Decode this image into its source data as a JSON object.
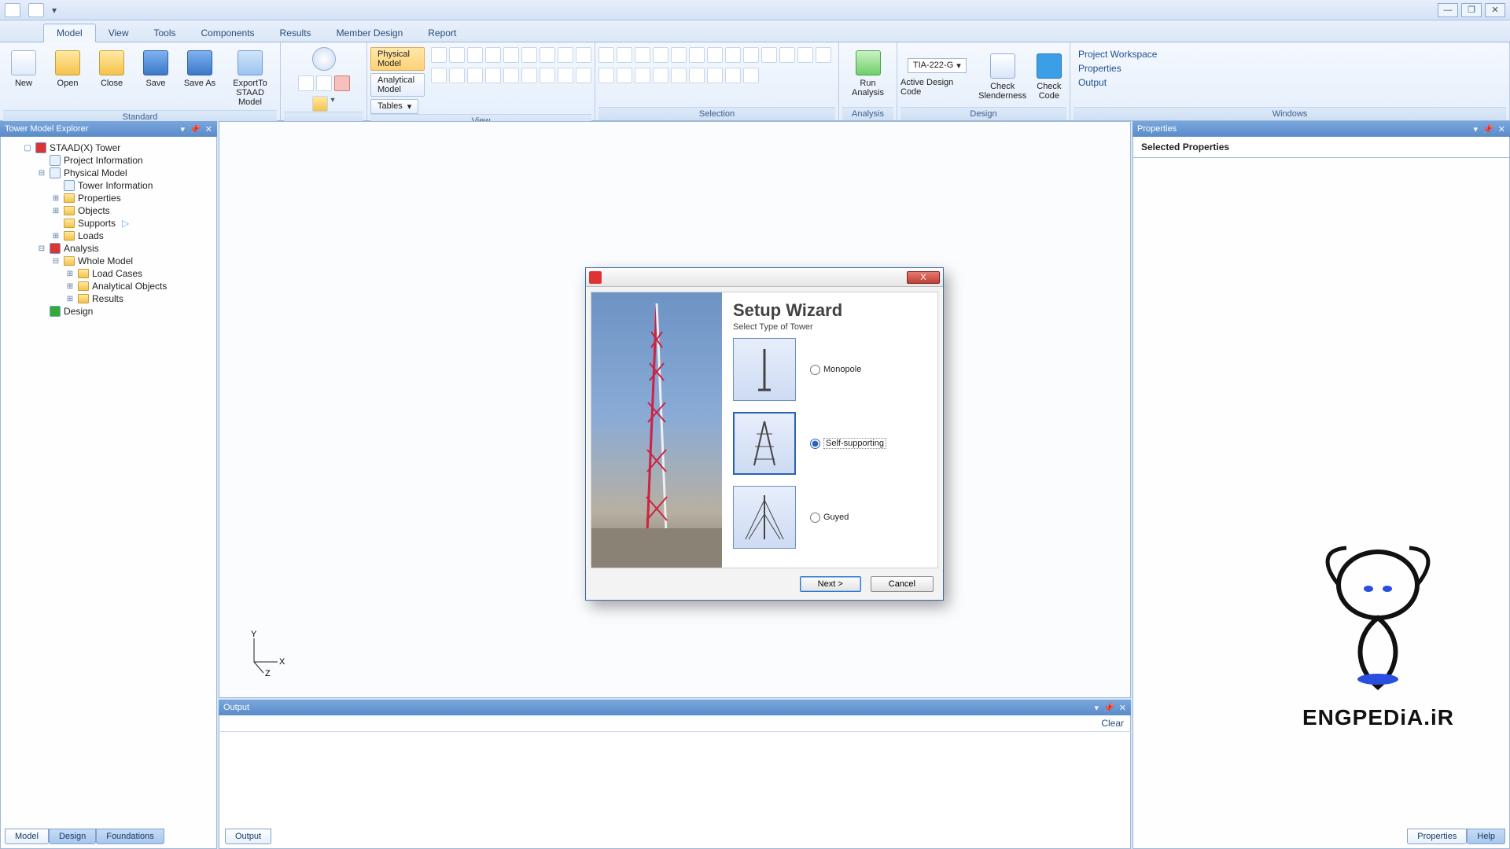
{
  "titlebar": {
    "min": "—",
    "max": "❐",
    "close": "✕"
  },
  "tabs": [
    "Model",
    "View",
    "Tools",
    "Components",
    "Results",
    "Member Design",
    "Report"
  ],
  "active_tab": 0,
  "ribbon": {
    "standard": {
      "label": "Standard",
      "buttons": [
        "New",
        "Open",
        "Close",
        "Save",
        "Save As",
        "ExportTo STAAD Model"
      ]
    },
    "view": {
      "label": "View",
      "stack": [
        "Physical Model",
        "Analytical Model",
        "Tables"
      ]
    },
    "selection": {
      "label": "Selection"
    },
    "analysis": {
      "label": "Analysis",
      "run": "Run Analysis"
    },
    "design": {
      "label": "Design",
      "code_value": "TIA-222-G",
      "active_code": "Active Design Code",
      "check_slender": "Check Slenderness",
      "check_code": "Check Code"
    },
    "windows": {
      "label": "Windows",
      "links": [
        "Project Workspace",
        "Properties",
        "Output"
      ]
    }
  },
  "explorer": {
    "title": "Tower Model Explorer",
    "root": "STAAD(X) Tower",
    "items": {
      "project_info": "Project Information",
      "physical_model": "Physical Model",
      "tower_info": "Tower Information",
      "properties": "Properties",
      "objects": "Objects",
      "supports": "Supports",
      "loads": "Loads",
      "analysis": "Analysis",
      "whole_model": "Whole Model",
      "load_cases": "Load Cases",
      "analytical_objects": "Analytical Objects",
      "results": "Results",
      "design": "Design"
    }
  },
  "axis": {
    "x": "X",
    "y": "Y",
    "z": "Z"
  },
  "output": {
    "title": "Output",
    "clear": "Clear",
    "tab": "Output"
  },
  "left_bottom_tabs": [
    "Model",
    "Design",
    "Foundations"
  ],
  "properties_panel": {
    "title": "Properties",
    "selected": "Selected Properties"
  },
  "right_bottom_tabs": [
    "Properties",
    "Help"
  ],
  "dialog": {
    "title": "Setup Wizard",
    "subtitle": "Select Type of Tower",
    "options": [
      "Monopole",
      "Self-supporting",
      "Guyed"
    ],
    "selected": 1,
    "next": "Next >",
    "cancel": "Cancel",
    "close": "X"
  },
  "watermark": "ENGPEDiA.iR"
}
